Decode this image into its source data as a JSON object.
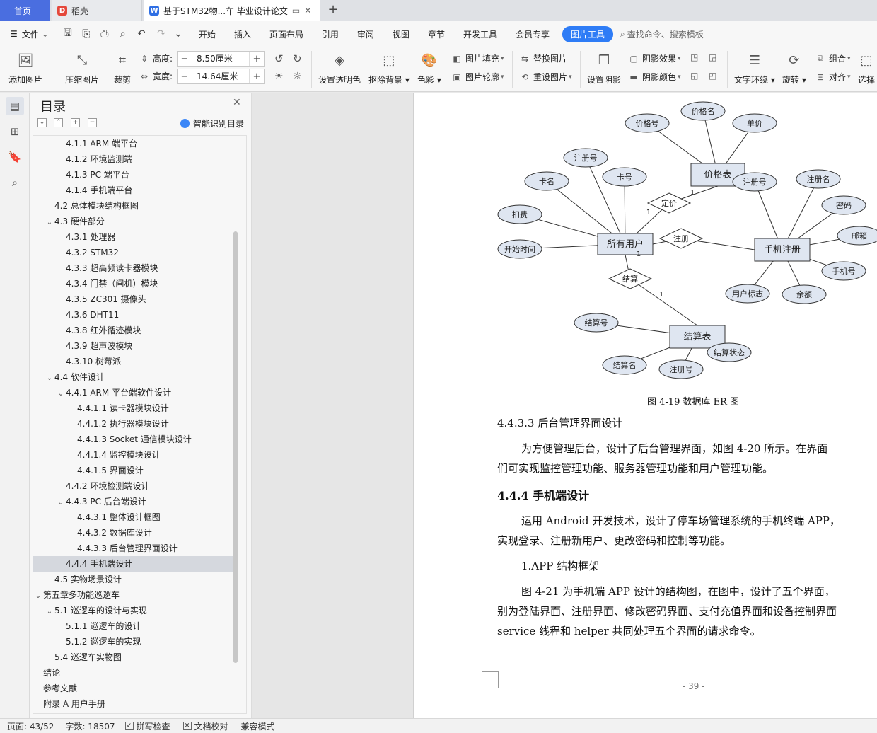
{
  "tabs": {
    "home": "首页",
    "daoke": "稻壳",
    "doc": "基于STM32物...车 毕业设计论文",
    "add": "+"
  },
  "menu": {
    "file": "文件",
    "items": [
      "开始",
      "插入",
      "页面布局",
      "引用",
      "审阅",
      "视图",
      "章节",
      "开发工具",
      "会员专享"
    ],
    "active": "图片工具",
    "search": "查找命令、搜索模板"
  },
  "ribbon": {
    "add_image": "添加图片",
    "compress": "压缩图片",
    "crop": "裁剪",
    "height_label": "高度:",
    "height_value": "8.50厘米",
    "width_label": "宽度:",
    "width_value": "14.64厘米",
    "transparent": "设置透明色",
    "remove_bg": "抠除背景",
    "color": "色彩",
    "fill": "图片填充",
    "outline": "图片轮廓",
    "replace": "替换图片",
    "reset": "重设图片",
    "set_shadow": "设置阴影",
    "shadow_effect": "阴影效果",
    "shadow_color": "阴影颜色",
    "text_wrap": "文字环绕",
    "rotate": "旋转",
    "group": "组合",
    "align": "对齐",
    "select": "选择"
  },
  "toc": {
    "title": "目录",
    "ai_label": "智能识别目录",
    "items": [
      {
        "text": "4.1.1 ARM 端平台",
        "level": 3,
        "caret": ""
      },
      {
        "text": "4.1.2  环境监测端",
        "level": 3,
        "caret": ""
      },
      {
        "text": "4.1.3 PC 端平台",
        "level": 3,
        "caret": ""
      },
      {
        "text": "4.1.4  手机端平台",
        "level": 3,
        "caret": ""
      },
      {
        "text": "4.2  总体模块结构框图",
        "level": 2,
        "caret": ""
      },
      {
        "text": "4.3  硬件部分",
        "level": 2,
        "caret": "v"
      },
      {
        "text": "4.3.1  处理器",
        "level": 3,
        "caret": ""
      },
      {
        "text": "4.3.2 STM32",
        "level": 3,
        "caret": ""
      },
      {
        "text": "4.3.3  超高频读卡器模块",
        "level": 3,
        "caret": ""
      },
      {
        "text": "4.3.4  门禁（闸机）模块",
        "level": 3,
        "caret": ""
      },
      {
        "text": "4.3.5 ZC301 摄像头",
        "level": 3,
        "caret": ""
      },
      {
        "text": "4.3.6 DHT11",
        "level": 3,
        "caret": ""
      },
      {
        "text": "4.3.8  红外循迹模块",
        "level": 3,
        "caret": ""
      },
      {
        "text": "4.3.9  超声波模块",
        "level": 3,
        "caret": ""
      },
      {
        "text": "4.3.10  树莓派",
        "level": 3,
        "caret": ""
      },
      {
        "text": "4.4  软件设计",
        "level": 2,
        "caret": "v"
      },
      {
        "text": "4.4.1 ARM 平台端软件设计",
        "level": 3,
        "caret": "v"
      },
      {
        "text": "4.4.1.1  读卡器模块设计",
        "level": 4,
        "caret": ""
      },
      {
        "text": "4.4.1.2  执行器模块设计",
        "level": 4,
        "caret": ""
      },
      {
        "text": "4.4.1.3 Socket 通信模块设计",
        "level": 4,
        "caret": ""
      },
      {
        "text": "4.4.1.4  监控模块设计",
        "level": 4,
        "caret": ""
      },
      {
        "text": "4.4.1.5  界面设计",
        "level": 4,
        "caret": ""
      },
      {
        "text": "4.4.2  环境检测端设计",
        "level": 3,
        "caret": ""
      },
      {
        "text": "4.4.3 PC 后台端设计",
        "level": 3,
        "caret": "v"
      },
      {
        "text": "4.4.3.1  整体设计框图",
        "level": 4,
        "caret": ""
      },
      {
        "text": "4.4.3.2  数据库设计",
        "level": 4,
        "caret": ""
      },
      {
        "text": "4.4.3.3  后台管理界面设计",
        "level": 4,
        "caret": ""
      },
      {
        "text": "4.4.4  手机端设计",
        "level": 3,
        "caret": "",
        "selected": true
      },
      {
        "text": "4.5  实物场景设计",
        "level": 2,
        "caret": ""
      },
      {
        "text": "第五章多功能巡逻车",
        "level": 1,
        "caret": "v"
      },
      {
        "text": "5.1  巡逻车的设计与实现",
        "level": 2,
        "caret": "v"
      },
      {
        "text": "5.1.1  巡逻车的设计",
        "level": 3,
        "caret": ""
      },
      {
        "text": "5.1.2  巡逻车的实现",
        "level": 3,
        "caret": ""
      },
      {
        "text": "5.4  巡逻车实物图",
        "level": 2,
        "caret": ""
      },
      {
        "text": "结论",
        "level": 1,
        "caret": ""
      },
      {
        "text": "参考文献",
        "level": 1,
        "caret": ""
      },
      {
        "text": "附录 A  用户手册",
        "level": 1,
        "caret": ""
      }
    ]
  },
  "er": {
    "entities": [
      "价格表",
      "所有用户",
      "手机注册",
      "结算表"
    ],
    "relations": [
      "定价",
      "注册",
      "结算"
    ],
    "attributes": [
      "价格号",
      "价格名",
      "单价",
      "注册号",
      "卡名",
      "卡号",
      "扣费",
      "开始时间",
      "注册号",
      "注册名",
      "密码",
      "邮箱",
      "手机号",
      "用户标志",
      "余额",
      "结算号",
      "结算名",
      "注册号",
      "结算状态"
    ],
    "cardinalities": [
      "1",
      "1",
      "1",
      "1"
    ]
  },
  "document": {
    "fig_caption": "图 4-19 数据库 ER 图",
    "sec_4433": "4.4.3.3  后台管理界面设计",
    "para1_l1": "为方便管理后台，设计了后台管理界面，如图 4-20 所示。在界面",
    "para1_l2": "们可实现监控管理功能、服务器管理功能和用户管理功能。",
    "sec_444": "4.4.4  手机端设计",
    "para2_l1": "运用 Android 开发技术，设计了停车场管理系统的手机终端 APP，",
    "para2_l2": "实现登录、注册新用户、更改密码和控制等功能。",
    "sub_1": "1.APP 结构框架",
    "para3_l1": "图 4-21 为手机端 APP 设计的结构图，在图中，设计了五个界面，",
    "para3_l2": "别为登陆界面、注册界面、修改密码界面、支付充值界面和设备控制界面",
    "para3_l3": "service 线程和 helper 共同处理五个界面的请求命令。",
    "page_num": "- 39 -"
  },
  "status": {
    "page": "页面: 43/52",
    "words": "字数: 18507",
    "spell": "拼写检查",
    "proof": "文档校对",
    "compat": "兼容模式"
  },
  "colors": {
    "accent": "#2e7cf6",
    "home_tab": "#4a6ee0",
    "er_fill": "#dfe6f1",
    "er_stroke": "#333333"
  }
}
